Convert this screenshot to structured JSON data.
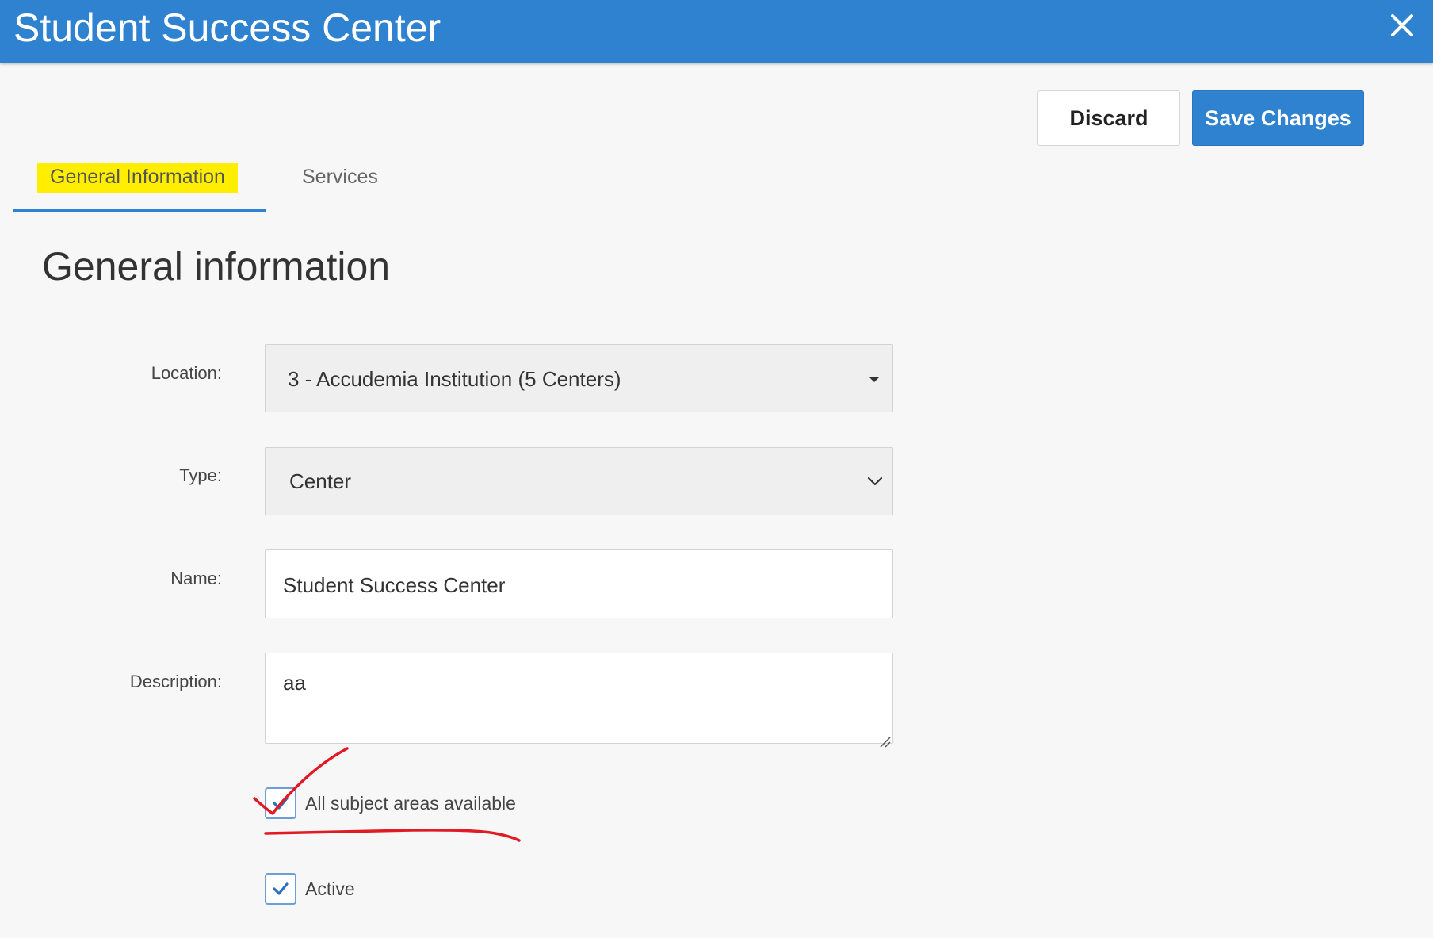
{
  "window": {
    "title": "Student Success Center"
  },
  "toolbar": {
    "discard_label": "Discard",
    "save_label": "Save Changes"
  },
  "tabs": [
    {
      "label": "General Information",
      "active": true
    },
    {
      "label": "Services",
      "active": false
    }
  ],
  "section": {
    "title": "General information"
  },
  "form": {
    "location": {
      "label": "Location:",
      "value": "3 - Accudemia Institution (5 Centers)"
    },
    "type": {
      "label": "Type:",
      "value": "Center"
    },
    "name": {
      "label": "Name:",
      "value": "Student Success Center"
    },
    "description": {
      "label": "Description:",
      "value": "aa"
    },
    "all_subjects": {
      "label": "All subject areas available",
      "checked": true
    },
    "active": {
      "label": "Active",
      "checked": true
    }
  },
  "colors": {
    "accent": "#2f82d0",
    "highlight": "#ffee00",
    "annotation": "#e01b24"
  }
}
